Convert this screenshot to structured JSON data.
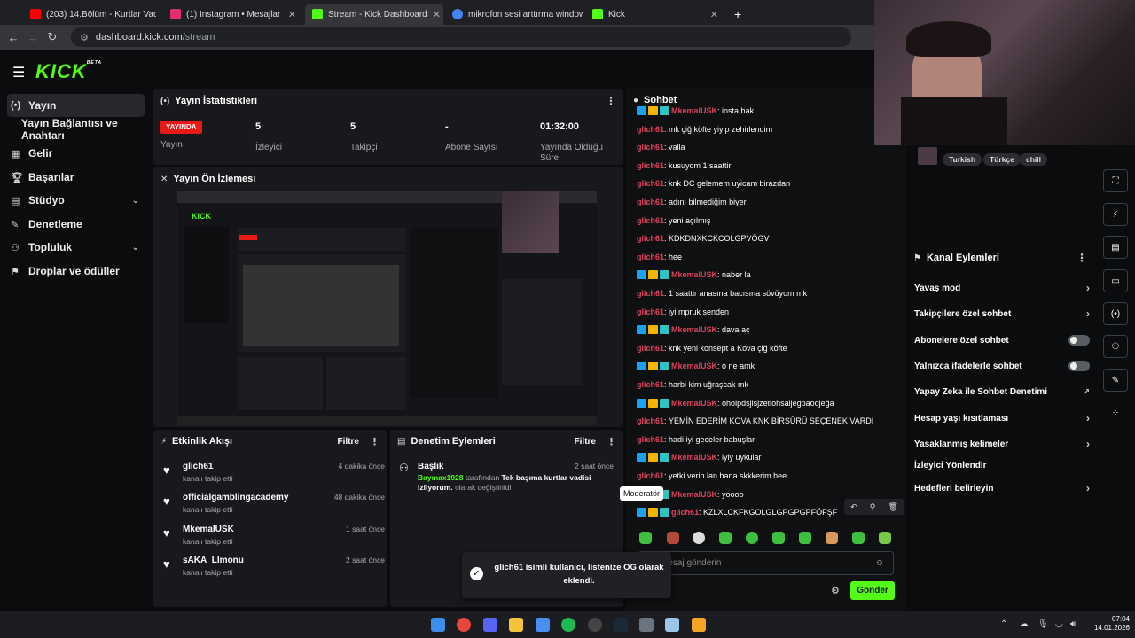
{
  "browser": {
    "tabs": [
      {
        "label": "(203) 14.Bölüm - Kurtlar Vadisi Pusu",
        "color": "#ff0000"
      },
      {
        "label": "(1) Instagram • Mesajlar",
        "color": "#e1306c"
      },
      {
        "label": "Stream - Kick Dashboard",
        "color": "#53fc18"
      },
      {
        "label": "mikrofon sesi arttırma windows",
        "color": "#4285f4"
      },
      {
        "label": "Kick",
        "color": "#53fc18"
      }
    ],
    "url_host": "dashboard.kick.com",
    "url_path": "/stream"
  },
  "brand": {
    "logo": "KICK",
    "beta": "BETA",
    "accent": "#53fc18"
  },
  "sidebar": {
    "items": [
      {
        "label": "Yayın",
        "icon": "broadcast-icon"
      },
      {
        "label": "Yayın Bağlantısı ve Anahtarı"
      },
      {
        "label": "Gelir",
        "icon": "revenue-icon"
      },
      {
        "label": "Başarılar",
        "icon": "trophy-icon"
      },
      {
        "label": "Stüdyo",
        "icon": "studio-icon"
      },
      {
        "label": "Denetleme",
        "icon": "wrench-icon"
      },
      {
        "label": "Topluluk",
        "icon": "community-icon"
      },
      {
        "label": "Droplar ve ödüller",
        "icon": "drops-icon"
      }
    ]
  },
  "stats": {
    "title": "Yayın İstatistikleri",
    "live_badge": "YAYINDA",
    "live_label": "Yayın",
    "items": [
      {
        "value": "5",
        "label": "İzleyici"
      },
      {
        "value": "5",
        "label": "Takipçi"
      },
      {
        "value": "-",
        "label": "Abone Sayısı"
      },
      {
        "value": "01:32:00",
        "label": "Yayında Olduğu Süre"
      }
    ]
  },
  "preview": {
    "title": "Yayın Ön İzlemesi"
  },
  "activity": {
    "title": "Etkinlik Akışı",
    "filter": "Filtre",
    "items": [
      {
        "name": "glich61",
        "action": "kanalı takip etti",
        "time": "4 dakika önce"
      },
      {
        "name": "officialgamblingacademy",
        "action": "kanalı takip etti",
        "time": "48 dakika önce"
      },
      {
        "name": "MkemalUSK",
        "action": "kanalı takip etti",
        "time": "1 saat önce"
      },
      {
        "name": "sAKA_Llmonu",
        "action": "kanalı takip etti",
        "time": "2 saat önce"
      }
    ]
  },
  "modlog": {
    "title": "Denetim Eylemleri",
    "filter": "Filtre",
    "item_title": "Başlık",
    "time": "2 saat önce",
    "user": "Baymax1928",
    "by": "tarafından",
    "value": "Tek başıma kurtlar vadisi izliyorum.",
    "changed": "olarak değiştirildi"
  },
  "toast": {
    "text": "glich61 isimli kullanıcı, listenize OG olarak eklendi."
  },
  "chat": {
    "title": "Sohbet",
    "messages": [
      {
        "user": "MkemalUSK",
        "text": "insta bak",
        "badges": true
      },
      {
        "user": "glich61",
        "text": "mk çiğ köfte yiyip zehirlendim"
      },
      {
        "user": "glich61",
        "text": "valla"
      },
      {
        "user": "glich61",
        "text": "kusuyom 1 saattir"
      },
      {
        "user": "glich61",
        "text": "knk DC gelemem uyicam birazdan"
      },
      {
        "user": "glich61",
        "text": "adını bilmediğim biyer"
      },
      {
        "user": "glich61",
        "text": "yeni açılmış"
      },
      {
        "user": "glich61",
        "text": "KDKDNXKCKCOLGPVÖGV"
      },
      {
        "user": "glich61",
        "text": "hee"
      },
      {
        "user": "MkemalUSK",
        "text": "naber la",
        "badges": true
      },
      {
        "user": "glich61",
        "text": "1 saattir anasına bacısına sövüyom mk"
      },
      {
        "user": "glich61",
        "text": "iyi mpruk senden"
      },
      {
        "user": "MkemalUSK",
        "text": "dava aç",
        "badges": true
      },
      {
        "user": "glich61",
        "text": "knk yeni konsept a Kova çiğ köfte"
      },
      {
        "user": "MkemalUSK",
        "text": "o ne amk",
        "badges": true
      },
      {
        "user": "glich61",
        "text": "harbi kim uğraşcak mk"
      },
      {
        "user": "MkemalUSK",
        "text": "ohoipdsjisjzetiohsaijegpaoojeğa",
        "badges": true
      },
      {
        "user": "glich61",
        "text": "YEMİN EDERİM KOVA KNK BİRSÜRÜ SEÇENEK VARDI"
      },
      {
        "user": "glich61",
        "text": "hadi iyi geceler babuşlar"
      },
      {
        "user": "MkemalUSK",
        "text": "iyiy uykular",
        "badges": true
      },
      {
        "user": "glich61",
        "text": "yetki verin lan bana skkkerim hee"
      },
      {
        "user": "MkemalUSK",
        "text": "yoooo",
        "badges": true
      },
      {
        "user": "glich61",
        "text": "KZLXLCKFKGOLGLGPGPGPFÖFŞF",
        "badges": true
      }
    ],
    "tooltip": "Moderatör",
    "input_placeholder": "Bir mesaj gönderin",
    "send": "Gönder",
    "username_color": "#e0435b",
    "mod_color": "#8a45d8"
  },
  "stream_info": {
    "title_partial": "Sohbet",
    "tags": [
      "Turkish",
      "Türkçe",
      "chill"
    ]
  },
  "channel_actions": {
    "title": "Kanal Eylemleri",
    "items": [
      {
        "label": "Yavaş mod",
        "type": "chevron"
      },
      {
        "label": "Takipçilere özel sohbet",
        "type": "chevron"
      },
      {
        "label": "Abonelere özel sohbet",
        "type": "toggle"
      },
      {
        "label": "Yalnızca ifadelerle sohbet",
        "type": "toggle"
      },
      {
        "label": "Yapay Zeka ile Sohbet Denetimi",
        "type": "external"
      },
      {
        "label": "Hesap yaşı kısıtlaması",
        "type": "chevron"
      },
      {
        "label": "Yasaklanmış kelimeler",
        "type": "chevron"
      },
      {
        "label": "İzleyici Yönlendir",
        "type": "none"
      },
      {
        "label": "Hedefleri belirleyin",
        "type": "chevron"
      }
    ]
  },
  "taskbar": {
    "time": "07:04",
    "date": "14.01.2026"
  }
}
